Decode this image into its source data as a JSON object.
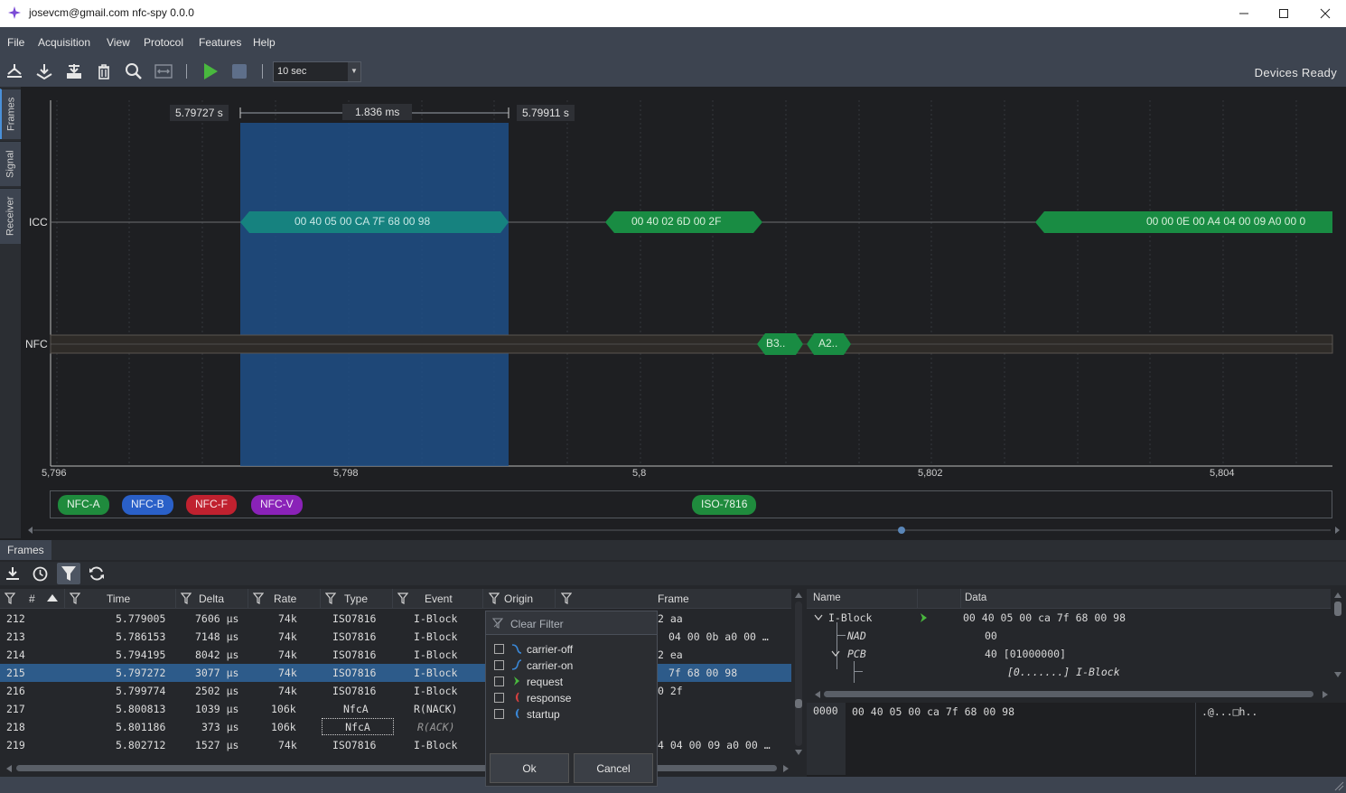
{
  "window": {
    "title": "josevcm@gmail.com nfc-spy 0.0.0",
    "controls": [
      "minimize",
      "maximize",
      "close"
    ]
  },
  "menu": [
    "File",
    "Acquisition",
    "View",
    "Protocol",
    "Features",
    "Help"
  ],
  "toolbar": {
    "icons": [
      "open-icon",
      "save-icon",
      "export-icon",
      "delete-icon",
      "zoom-icon",
      "fit-icon",
      "play-icon",
      "stop-icon"
    ],
    "time_window": "10 sec",
    "status": "Devices Ready"
  },
  "left_tabs": [
    "Frames",
    "Signal",
    "Receiver"
  ],
  "timeline": {
    "channels": [
      "ICC",
      "NFC"
    ],
    "selection_start": "5.79727 s",
    "selection_width": "1.836 ms",
    "selection_end": "5.79911 s",
    "icc_frames": [
      "00 40 05 00 CA 7F 68 00 98",
      "00 40 02 6D 00 2F",
      "00 00 0E 00 A4 04 00 09 A0 00 0"
    ],
    "nfc_frames": [
      "B3..",
      "A2.."
    ],
    "axis_ticks": [
      "5,796",
      "5,798",
      "5,8",
      "5,802",
      "5,804"
    ],
    "protocol_legend": [
      {
        "label": "NFC-A",
        "color": "#1f8b3d"
      },
      {
        "label": "NFC-B",
        "color": "#2a60c8"
      },
      {
        "label": "NFC-F",
        "color": "#c0212f"
      },
      {
        "label": "NFC-V",
        "color": "#8a22b8"
      },
      {
        "label": "ISO-7816",
        "color": "#1f8b3d"
      }
    ]
  },
  "frames_panel": {
    "tab": "Frames",
    "columns": [
      "#",
      "Time",
      "Delta",
      "Rate",
      "Type",
      "Event",
      "Origin",
      "Frame"
    ],
    "rows": [
      {
        "n": "212",
        "time": "5.779005",
        "delta": "7606 µs",
        "rate": "74k",
        "type": "ISO7816",
        "event": "I-Block",
        "frame": "2 aa"
      },
      {
        "n": "213",
        "time": "5.786153",
        "delta": "7148 µs",
        "rate": "74k",
        "type": "ISO7816",
        "event": "I-Block",
        "frame": "04 00 0b a0 00 …"
      },
      {
        "n": "214",
        "time": "5.794195",
        "delta": "8042 µs",
        "rate": "74k",
        "type": "ISO7816",
        "event": "I-Block",
        "frame": "2 ea"
      },
      {
        "n": "215",
        "time": "5.797272",
        "delta": "3077 µs",
        "rate": "74k",
        "type": "ISO7816",
        "event": "I-Block",
        "frame": "7f 68 00 98"
      },
      {
        "n": "216",
        "time": "5.799774",
        "delta": "2502 µs",
        "rate": "74k",
        "type": "ISO7816",
        "event": "I-Block",
        "frame": "0 2f"
      },
      {
        "n": "217",
        "time": "5.800813",
        "delta": "1039 µs",
        "rate": "106k",
        "type": "NfcA",
        "event": "R(NACK)",
        "frame": ""
      },
      {
        "n": "218",
        "time": "5.801186",
        "delta": "373 µs",
        "rate": "106k",
        "type": "NfcA",
        "event": "R(ACK)",
        "frame": ""
      },
      {
        "n": "219",
        "time": "5.802712",
        "delta": "1527 µs",
        "rate": "74k",
        "type": "ISO7816",
        "event": "I-Block",
        "frame": "4 04 00 09 a0 00 …"
      }
    ]
  },
  "origin_filter": {
    "clear_label": "Clear Filter",
    "options": [
      "carrier-off",
      "carrier-on",
      "request",
      "response",
      "startup"
    ],
    "ok": "Ok",
    "cancel": "Cancel"
  },
  "detail_panel": {
    "columns": [
      "Name",
      "Data"
    ],
    "tree": [
      {
        "name": "I-Block",
        "data": "00 40 05 00 ca 7f 68 00 98"
      },
      {
        "name": "NAD",
        "data": "00"
      },
      {
        "name": "PCB",
        "data": "40 [01000000]"
      },
      {
        "name": "",
        "data": "[0.......] I-Block"
      }
    ],
    "hex_offset": "0000",
    "hex_bytes": "00 40 05 00 ca 7f 68 00 98",
    "hex_ascii": ".@...□h.."
  }
}
